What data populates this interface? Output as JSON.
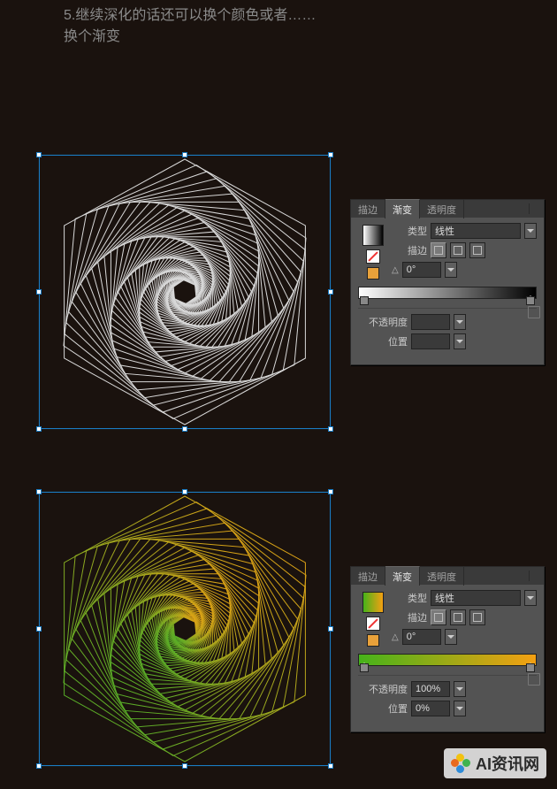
{
  "heading": {
    "line1": "5.继续深化的话还可以换个颜色或者……",
    "line2": "换个渐变"
  },
  "panel_tabs": {
    "stroke": "描边",
    "gradient": "渐变",
    "transparency": "透明度"
  },
  "labels": {
    "type": "类型",
    "stroke": "描边",
    "opacity": "不透明度",
    "location": "位置"
  },
  "panel1": {
    "type_value": "线性",
    "angle": "0°",
    "opacity": "",
    "location": "",
    "gradient": "white-black"
  },
  "panel2": {
    "type_value": "线性",
    "angle": "0°",
    "opacity": "100%",
    "location": "0%",
    "gradient": "green-orange"
  },
  "artwork": {
    "shape": "hexagon-spiral",
    "iterations": 60,
    "rotation_step_deg": 5,
    "scale_step": 0.96
  },
  "watermark": "AI资讯网"
}
